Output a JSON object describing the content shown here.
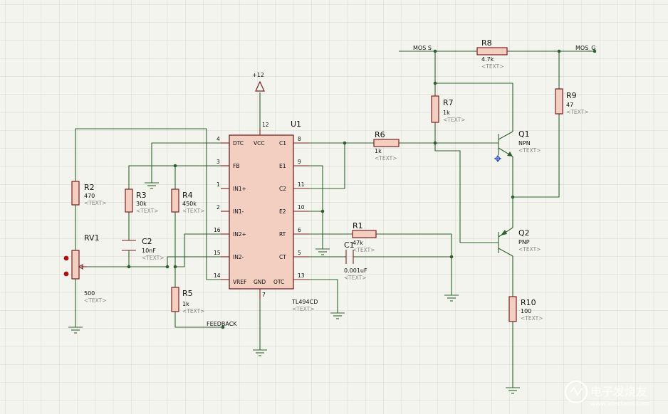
{
  "title": "",
  "watermark": {
    "text": "电子发烧友",
    "sub": "www.elecfans.com"
  },
  "ic": {
    "ref": "U1",
    "value": "TL494CD",
    "text": "<TEXT>",
    "pins_left": [
      {
        "num": "4",
        "name": "DTC"
      },
      {
        "num": "3",
        "name": "FB"
      },
      {
        "num": "1",
        "name": "IN1+"
      },
      {
        "num": "2",
        "name": "IN1-"
      },
      {
        "num": "16",
        "name": "IN2+"
      },
      {
        "num": "15",
        "name": "IN2-"
      },
      {
        "num": "14",
        "name": "VREF"
      }
    ],
    "pins_right": [
      {
        "num": "8",
        "name": "C1"
      },
      {
        "num": "9",
        "name": "E1"
      },
      {
        "num": "11",
        "name": "C2"
      },
      {
        "num": "10",
        "name": "E2"
      },
      {
        "num": "6",
        "name": "RT"
      },
      {
        "num": "5",
        "name": "CT"
      },
      {
        "num": "13",
        "name": "OTC"
      }
    ],
    "pin_vcc": {
      "num": "12",
      "name": "VCC"
    },
    "pin_gnd": {
      "num": "7",
      "name": "GND"
    }
  },
  "power": {
    "vcc": "+12"
  },
  "nets": {
    "mos_s": "MOS S",
    "mos_g": "MOS_G",
    "feedback": "FEEDBACK"
  },
  "components": {
    "R1": {
      "ref": "R1",
      "value": "47k",
      "text": "<TEXT>"
    },
    "R2": {
      "ref": "R2",
      "value": "470",
      "text": "<TEXT>"
    },
    "R3": {
      "ref": "R3",
      "value": "30k",
      "text": "<TEXT>"
    },
    "R4": {
      "ref": "R4",
      "value": "450k",
      "text": "<TEXT>"
    },
    "R5": {
      "ref": "R5",
      "value": "1k",
      "text": "<TEXT>"
    },
    "R6": {
      "ref": "R6",
      "value": "1k",
      "text": "<TEXT>"
    },
    "R7": {
      "ref": "R7",
      "value": "1k",
      "text": "<TEXT>"
    },
    "R8": {
      "ref": "R8",
      "value": "4.7k",
      "text": "<TEXT>"
    },
    "R9": {
      "ref": "R9",
      "value": "47",
      "text": "<TEXT>"
    },
    "R10": {
      "ref": "R10",
      "value": "100",
      "text": "<TEXT>"
    },
    "C1": {
      "ref": "C1",
      "value": "0.001uF",
      "text": "<TEXT>"
    },
    "C2": {
      "ref": "C2",
      "value": "10nF",
      "text": "<TEXT>"
    },
    "RV1": {
      "ref": "RV1",
      "value": "500",
      "text": "<TEXT>"
    },
    "Q1": {
      "ref": "Q1",
      "value": "NPN",
      "text": "<TEXT>"
    },
    "Q2": {
      "ref": "Q2",
      "value": "PNP",
      "text": "<TEXT>"
    }
  },
  "colors": {
    "grid": "#c9cfc4",
    "wire": "#2f5f2f",
    "component": "#7a2020",
    "fill": "#f2cfc0",
    "background": "#f4f4ee"
  }
}
